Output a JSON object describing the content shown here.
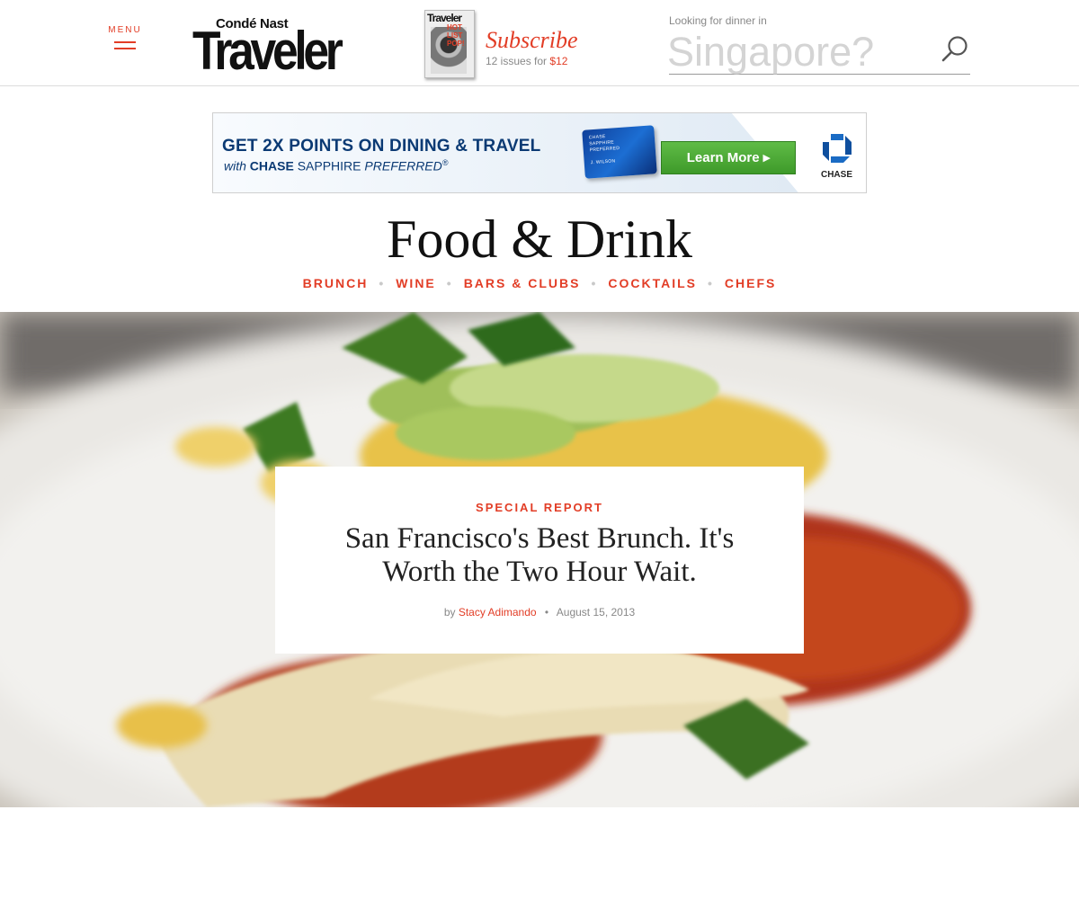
{
  "header": {
    "menu_label": "MENU",
    "logo_top": "Condé Nast",
    "logo_main": "Traveler",
    "subscribe": {
      "cover_title": "Traveler",
      "cover_tagline": "HOT LIST POP!",
      "title": "Subscribe",
      "line_prefix": "12 issues for",
      "price": "$12"
    },
    "search": {
      "label": "Looking for dinner in",
      "placeholder": "Singapore?"
    }
  },
  "ad": {
    "headline": "GET 2X POINTS ON DINING & TRAVEL",
    "sub_with": "with",
    "sub_brand": "CHASE",
    "sub_product": "SAPPHIRE",
    "sub_tier": "PREFERRED",
    "sub_mark": "®",
    "card_brand": "CHASE",
    "card_name": "SAPPHIRE",
    "card_tier": "PREFERRED",
    "card_holder": "J. WILSON",
    "button_label": "Learn More ▸",
    "logo_text": "CHASE",
    "brand_color": "#0b3a74",
    "button_color": "#4aa935"
  },
  "section": {
    "title": "Food & Drink",
    "nav": [
      "BRUNCH",
      "WINE",
      "BARS & CLUBS",
      "COCKTAILS",
      "CHEFS"
    ],
    "separator": "•"
  },
  "feature": {
    "kicker": "SPECIAL REPORT",
    "title": "San Francisco's Best Brunch. It's Worth the Two Hour Wait.",
    "by": "by",
    "author": "Stacy Adimando",
    "dot": "•",
    "date": "August 15, 2013"
  },
  "colors": {
    "accent": "#e23d26",
    "text": "#222222",
    "muted": "#888888"
  }
}
